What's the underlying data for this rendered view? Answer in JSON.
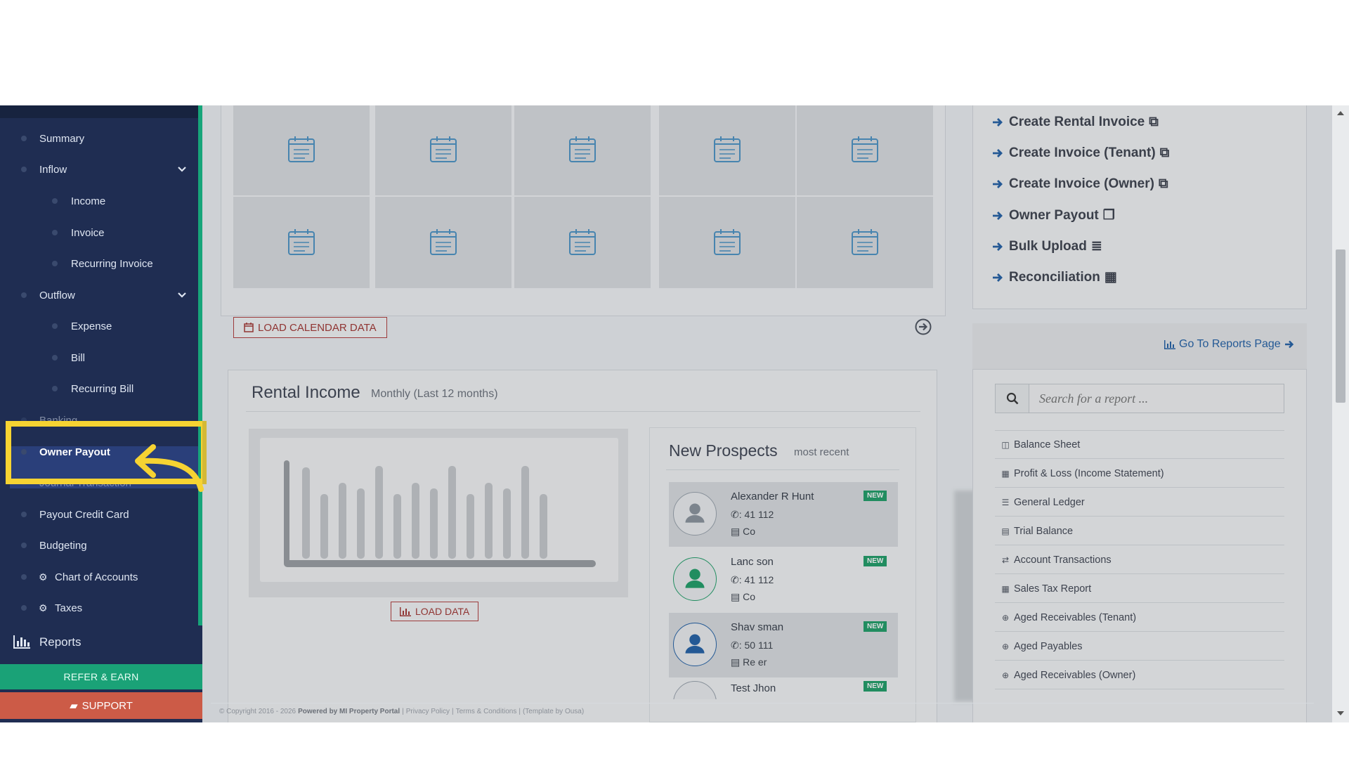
{
  "sidebar": {
    "items": [
      {
        "label": "Summary"
      },
      {
        "label": "Inflow"
      },
      {
        "label": "Income"
      },
      {
        "label": "Invoice"
      },
      {
        "label": "Recurring Invoice"
      },
      {
        "label": "Outflow"
      },
      {
        "label": "Expense"
      },
      {
        "label": "Bill"
      },
      {
        "label": "Recurring Bill"
      },
      {
        "label": "Banking"
      },
      {
        "label": "Owner Payout"
      },
      {
        "label": "Journal Transaction"
      },
      {
        "label": "Payout Credit Card"
      },
      {
        "label": "Budgeting"
      },
      {
        "label": "Chart of Accounts"
      },
      {
        "label": "Taxes"
      }
    ],
    "reports_label": "Reports",
    "refer_label": "REFER & EARN",
    "support_label": "SUPPORT"
  },
  "calendar": {
    "load_label": "LOAD CALENDAR DATA"
  },
  "rental_income": {
    "title": "Rental Income",
    "subtitle": "Monthly (Last 12 months)",
    "load_label": "LOAD DATA"
  },
  "prospects": {
    "title": "New Prospects",
    "subtitle": "most recent",
    "badge": "NEW",
    "rows": [
      {
        "name": "Alexander R Hunt",
        "phone": ": 41       112",
        "company": "Co"
      },
      {
        "name": "Lanc          son",
        "phone": ": 41       112",
        "company": "Co"
      },
      {
        "name": "Shav         sman",
        "phone": ": 50       111",
        "company": "Re          er"
      },
      {
        "name": "Test Jhon",
        "phone": "",
        "company": ""
      }
    ]
  },
  "quick_links": [
    {
      "label": "Create Rental Invoice",
      "icon": "copy-icon"
    },
    {
      "label": "Create Invoice (Tenant)",
      "icon": "copy-icon"
    },
    {
      "label": "Create Invoice (Owner)",
      "icon": "copy-icon"
    },
    {
      "label": "Owner Payout",
      "icon": "copy-outline-icon"
    },
    {
      "label": "Bulk Upload",
      "icon": "database-icon"
    },
    {
      "label": "Reconciliation",
      "icon": "calculator-icon"
    }
  ],
  "reports_panel": {
    "goto_label": "Go To Reports Page",
    "search_placeholder": "Search for a report ...",
    "items": [
      {
        "label": "Balance Sheet",
        "icon": "columns-icon"
      },
      {
        "label": "Profit & Loss (Income Statement)",
        "icon": "calculator-icon"
      },
      {
        "label": "General Ledger",
        "icon": "list-icon"
      },
      {
        "label": "Trial Balance",
        "icon": "calendar-icon"
      },
      {
        "label": "Account Transactions",
        "icon": "exchange-icon"
      },
      {
        "label": "Sales Tax Report",
        "icon": "calculator-icon"
      },
      {
        "label": "Aged Receivables (Tenant)",
        "icon": "plus-circle-icon"
      },
      {
        "label": "Aged Payables",
        "icon": "plus-circle-icon"
      },
      {
        "label": "Aged Receivables (Owner)",
        "icon": "plus-circle-icon"
      }
    ]
  },
  "footer": {
    "copyright": "© Copyright 2016 - 2026",
    "powered": "Powered by MI Property Portal",
    "privacy": "Privacy Policy",
    "terms": "Terms & Conditions",
    "template": "(Template by Ousa)"
  },
  "colors": {
    "sidebar_bg": "#1f2d52",
    "accent_green": "#1aa277",
    "support_red": "#cc5b47",
    "highlight_yellow": "#f6d332",
    "link_blue": "#1f5fa6",
    "button_red": "#a3332f"
  }
}
